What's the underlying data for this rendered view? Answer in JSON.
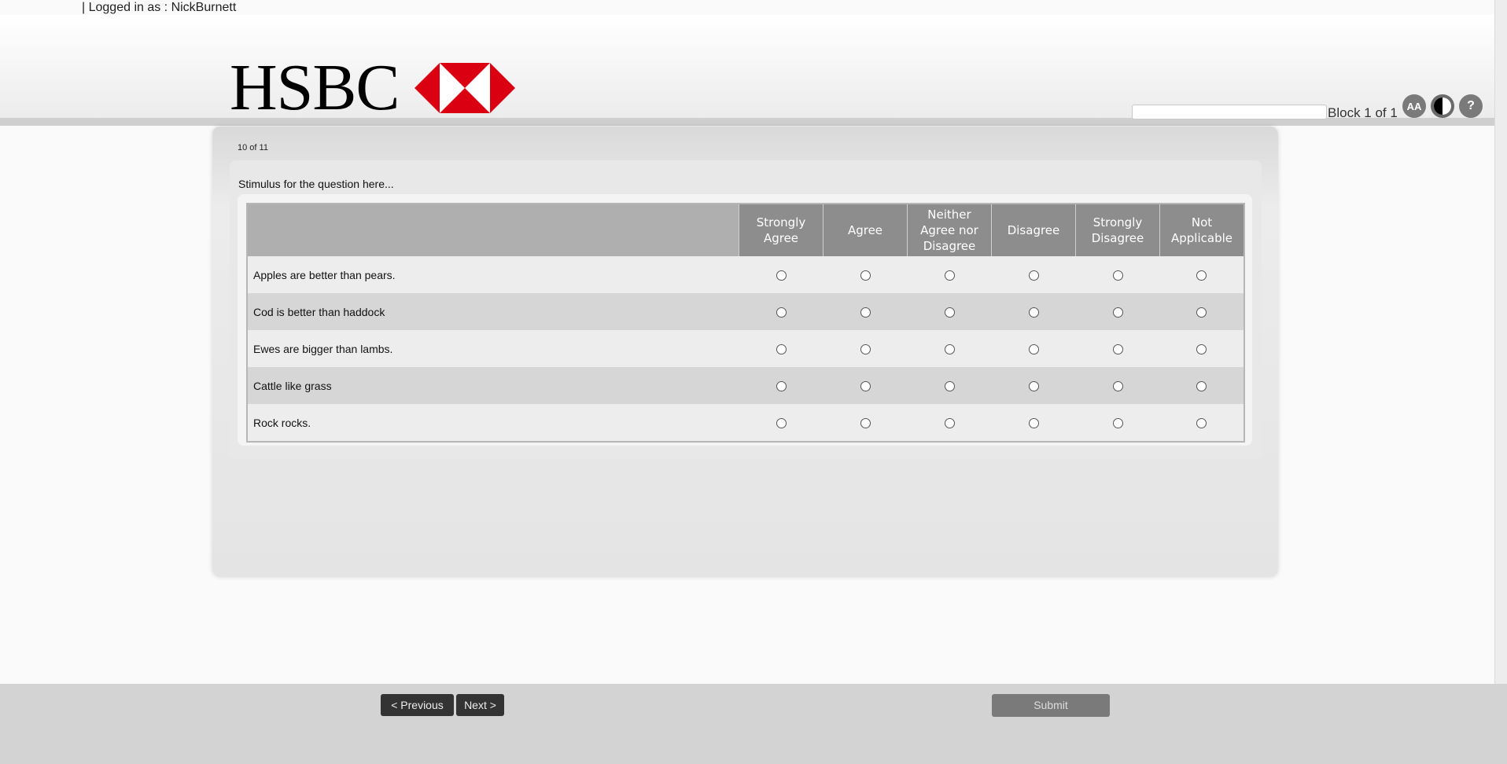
{
  "header": {
    "login_text": "| Logged in as : NickBurnett",
    "logo_text": "HSBC",
    "block_label": "Block 1 of 1",
    "search_value": "",
    "brand_red": "#db0011"
  },
  "toolbar": {
    "text_size_label": "AA",
    "contrast_icon": "contrast-icon",
    "help_label": "?"
  },
  "question": {
    "counter": "10  of 11",
    "stimulus": "Stimulus for the question here...",
    "columns": [
      "Strongly Agree",
      "Agree",
      "Neither Agree nor Disagree",
      "Disagree",
      "Strongly Disagree",
      "Not Applicable"
    ],
    "rows": [
      "Apples are better than pears.",
      "Cod is better than haddock",
      "Ewes are bigger than lambs.",
      "Cattle like grass",
      "Rock rocks."
    ]
  },
  "footer": {
    "previous_label": "< Previous",
    "next_label": "Next >",
    "submit_label": "Submit"
  }
}
